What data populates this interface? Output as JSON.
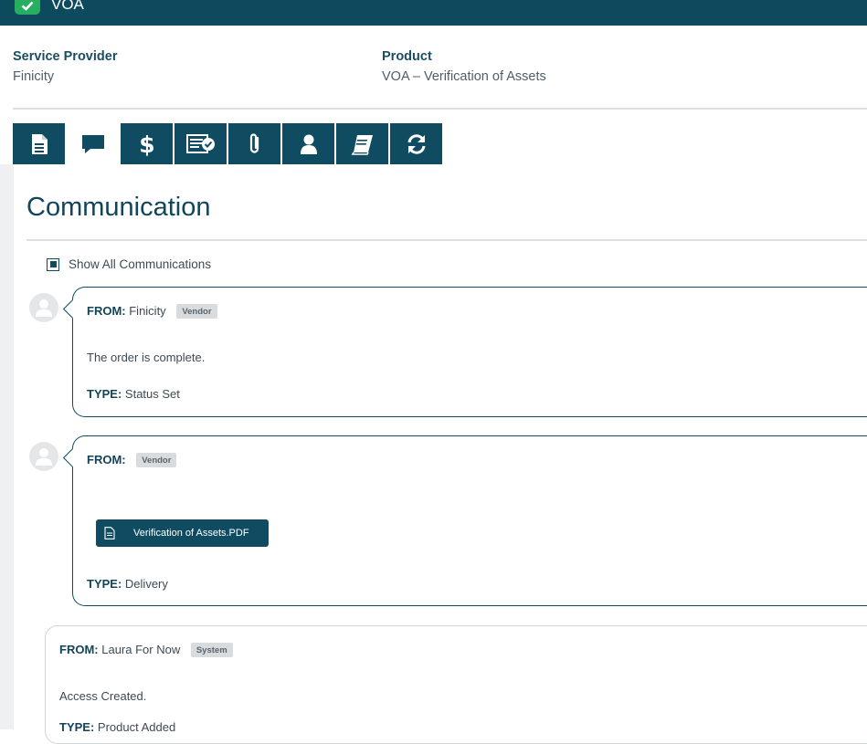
{
  "header": {
    "title": "VOA"
  },
  "info": {
    "provider_label": "Service Provider",
    "provider_value": "Finicity",
    "product_label": "Product",
    "product_value": "VOA – Verification of Assets"
  },
  "tabs": [
    {
      "icon": "document-icon",
      "active": false
    },
    {
      "icon": "comment-icon",
      "active": true
    },
    {
      "icon": "dollar-icon",
      "active": false
    },
    {
      "icon": "checklist-icon",
      "active": false
    },
    {
      "icon": "paperclip-icon",
      "active": false
    },
    {
      "icon": "user-icon",
      "active": false
    },
    {
      "icon": "book-icon",
      "active": false
    },
    {
      "icon": "refresh-icon",
      "active": false
    }
  ],
  "section": {
    "title": "Communication",
    "show_all_label": "Show All Communications"
  },
  "messages": [
    {
      "from_label": "FROM:",
      "from_name": "Finicity",
      "badge": "Vendor",
      "text": "The order is complete.",
      "type_label": "TYPE:",
      "type_value": "Status Set"
    },
    {
      "from_label": "FROM:",
      "from_name": "",
      "badge": "Vendor",
      "attachment": "Verification of Assets.PDF",
      "type_label": "TYPE:",
      "type_value": "Delivery"
    },
    {
      "from_label": "FROM:",
      "from_name": "Laura For Now",
      "badge": "System",
      "text": "Access Created.",
      "type_label": "TYPE:",
      "type_value": "Product Added"
    }
  ],
  "colors": {
    "primary": "#0f4c61",
    "accent_green": "#27ae60",
    "badge_bg": "#d9dcde"
  }
}
